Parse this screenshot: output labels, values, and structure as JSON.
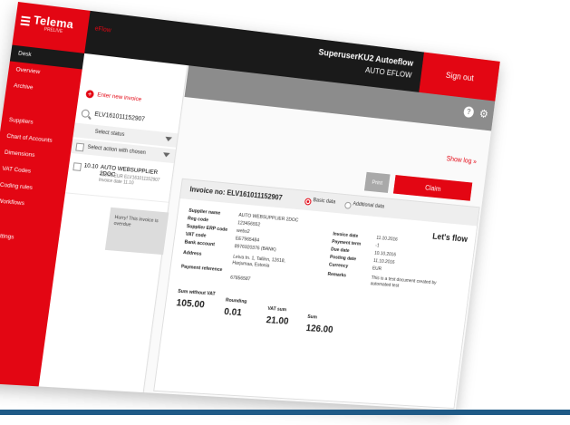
{
  "app": {
    "logo": "Telema",
    "logo_sub": "PRELIVE",
    "module": "eFlow",
    "user_name": "SuperuserKU2 Autoeflow",
    "user_company": "AUTO EFLOW",
    "sign_out": "Sign out"
  },
  "sidebar": {
    "items": [
      "Desk",
      "Overview",
      "Archive",
      "Suppliers",
      "Chart of Accounts",
      "Dimensions",
      "VAT Codes",
      "Coding rules",
      "Workflows",
      "Settings"
    ]
  },
  "search_panel": {
    "enter_new": "Enter new invoice",
    "search_value": "ELV161011152907",
    "select_status": "Select status",
    "select_action": "Select action with chosen",
    "list_item": {
      "date": "10.10",
      "name": "AUTO WEBSUPPLIER 2DOC",
      "sub1": "126.00 EUR ELV161011152907",
      "sub2": "Invoice date 11.10"
    },
    "overdue_text": "Hurry! This invoice is overdue"
  },
  "main": {
    "show_log": "Show log »",
    "print": "Print",
    "claim": "Claim",
    "invoice_title": "Invoice no: ELV161011152907",
    "radio_basic": "Basic data",
    "radio_additional": "Additional data",
    "lets_flow": "Let's flow"
  },
  "details": {
    "left": [
      {
        "label": "Supplier name",
        "value": "AUTO WEBSUPPLIER 2DOC"
      },
      {
        "label": "Reg code",
        "value": "123456552"
      },
      {
        "label": "Supplier ERP code",
        "value": "webs2"
      },
      {
        "label": "VAT code",
        "value": "EE7965484"
      },
      {
        "label": "Bank account",
        "value": "8976920376 (BANK)"
      },
      {
        "label": "Address",
        "value": "Leiva tn. 1, Tallinn, 12618, Harjumaa, Estonia"
      },
      {
        "label": "Payment reference",
        "value": "67856587"
      }
    ],
    "right": [
      {
        "label": "Invoice date",
        "value": "11.10.2016"
      },
      {
        "label": "Payment term",
        "value": "-1"
      },
      {
        "label": "Due date",
        "value": "10.10.2016"
      },
      {
        "label": "Posting date",
        "value": "11.10.2016"
      },
      {
        "label": "Currency",
        "value": "EUR"
      },
      {
        "label": "Remarks",
        "value": "This is a test document created by automated test"
      }
    ]
  },
  "sums": [
    {
      "label": "Sum without VAT",
      "value": "105.00"
    },
    {
      "label": "Rounding",
      "value": "0.01"
    },
    {
      "label": "VAT sum",
      "value": "21.00"
    },
    {
      "label": "Sum",
      "value": "126.00"
    }
  ],
  "colors": {
    "accent": "#e30613",
    "dark": "#1a1a1a",
    "rule": "#1f5a86"
  },
  "icons": [
    "hamburger-icon",
    "plus-icon",
    "search-icon",
    "chevron-down-icon",
    "help-icon",
    "gear-icon"
  ]
}
